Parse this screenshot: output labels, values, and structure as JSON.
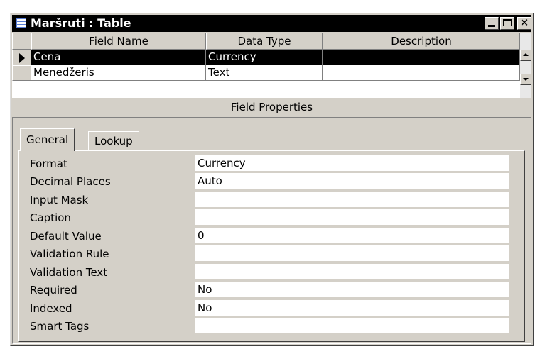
{
  "window": {
    "title": "Maršruti : Table",
    "buttons": {
      "minimize_icon": "minimize-icon",
      "maximize_icon": "maximize-icon",
      "close_label": "✕"
    }
  },
  "grid": {
    "columns": [
      "Field Name",
      "Data Type",
      "Description"
    ],
    "rows": [
      {
        "field_name": "Cena",
        "data_type": "Currency",
        "description": ""
      },
      {
        "field_name": "Menedžeris",
        "data_type": "Text",
        "description": ""
      }
    ]
  },
  "field_properties": {
    "label": "Field Properties",
    "tabs": [
      "General",
      "Lookup"
    ],
    "active_tab": "General",
    "properties": [
      {
        "label": "Format",
        "value": "Currency"
      },
      {
        "label": "Decimal Places",
        "value": "Auto"
      },
      {
        "label": "Input Mask",
        "value": ""
      },
      {
        "label": "Caption",
        "value": ""
      },
      {
        "label": "Default Value",
        "value": "0"
      },
      {
        "label": "Validation Rule",
        "value": ""
      },
      {
        "label": "Validation Text",
        "value": ""
      },
      {
        "label": "Required",
        "value": "No"
      },
      {
        "label": "Indexed",
        "value": "No"
      },
      {
        "label": "Smart Tags",
        "value": ""
      }
    ]
  }
}
